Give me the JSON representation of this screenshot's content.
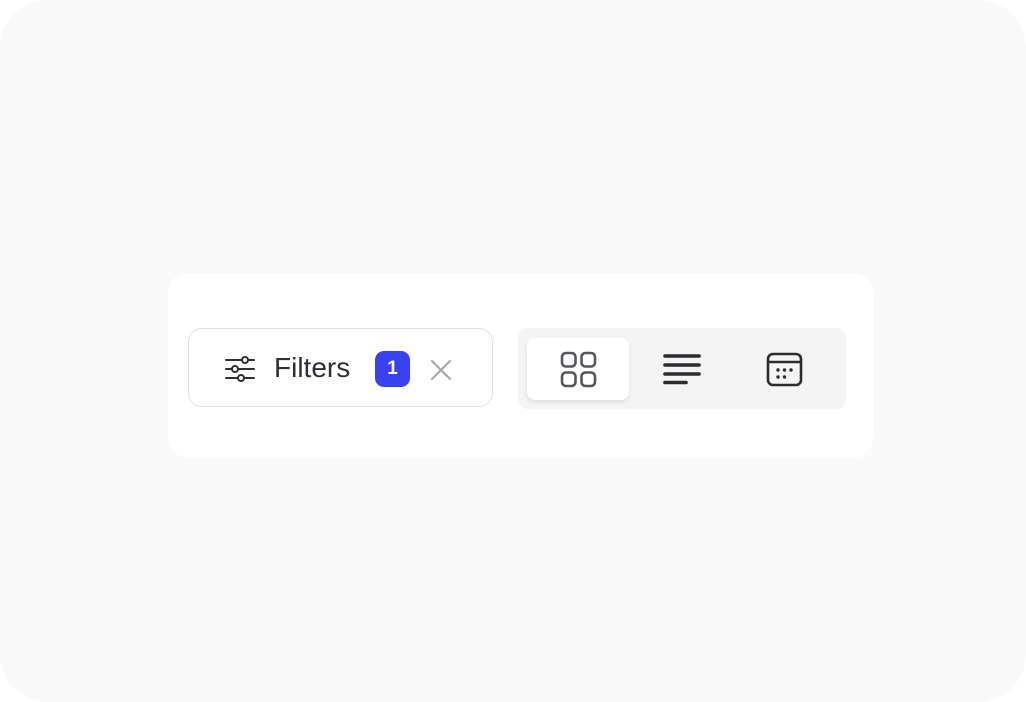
{
  "toolbar": {
    "filters": {
      "label": "Filters",
      "count": "1",
      "icon": "sliders-icon",
      "clear_icon": "close-icon"
    },
    "view_toggle": {
      "options": [
        {
          "name": "grid",
          "icon": "grid-icon",
          "selected": true
        },
        {
          "name": "list",
          "icon": "list-icon",
          "selected": false
        },
        {
          "name": "calendar",
          "icon": "calendar-icon",
          "selected": false
        }
      ]
    }
  },
  "colors": {
    "page_background": "#f9f9f9",
    "card_background": "#ffffff",
    "badge": "#3a41f1",
    "text": "#2f2f35",
    "clear_icon": "#a9a9ae",
    "toggle_background": "#f4f4f5"
  }
}
